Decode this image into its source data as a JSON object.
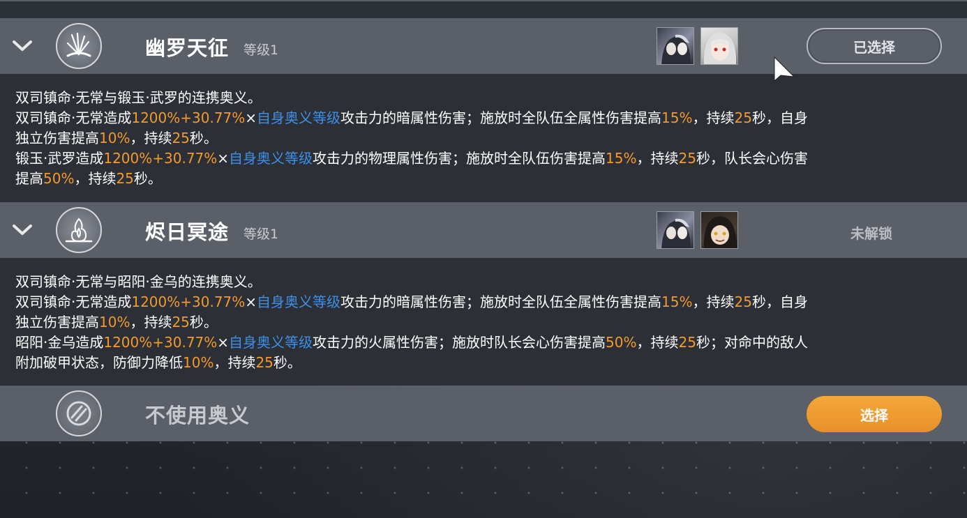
{
  "colors": {
    "header_bg": "#5b5f67",
    "desc_bg": "#2c2f35",
    "highlight_orange": "#f39a2d",
    "highlight_blue": "#3f8fe6",
    "select_button": "#f0a032"
  },
  "skills": [
    {
      "name": "幽罗天征",
      "level": "等级1",
      "status": "已选择",
      "icon": "burst-emblem-icon",
      "lines": [
        [
          "双司镇命·无常与锻玉·武罗的连携奥义。"
        ],
        [
          "双司镇命·无常造成",
          "1200%+30.77%",
          "×",
          "自身奥义等级",
          "攻击力的暗属性伤害；施放时全队伍全属性伤害提高",
          "15%",
          "，持续",
          "25",
          "秒，自身"
        ],
        [
          "独立伤害提高",
          "10%",
          "，持续",
          "25",
          "秒。"
        ],
        [
          "锻玉·武罗造成",
          "1200%+30.77%",
          "×",
          "自身奥义等级",
          "攻击力的物理属性伤害；施放时全队伍伤害提高",
          "15%",
          "，持续",
          "25",
          "秒，队长会心伤害"
        ],
        [
          "提高",
          "50%",
          "，持续",
          "25",
          "秒。"
        ]
      ]
    },
    {
      "name": "烬日冥途",
      "level": "等级1",
      "status": "未解锁",
      "icon": "flame-emblem-icon",
      "lines": [
        [
          "双司镇命·无常与昭阳·金乌的连携奥义。"
        ],
        [
          "双司镇命·无常造成",
          "1200%+30.77%",
          "×",
          "自身奥义等级",
          "攻击力的暗属性伤害；施放时全队伍全属性伤害提高",
          "15%",
          "，持续",
          "25",
          "秒，自身"
        ],
        [
          "独立伤害提高",
          "10%",
          "，持续",
          "25",
          "秒。"
        ],
        [
          "昭阳·金乌造成",
          "1200%+30.77%",
          "×",
          "自身奥义等级",
          "攻击力的火属性伤害；施放时队长会心伤害提高",
          "50%",
          "，持续",
          "25",
          "秒；对命中的敌人"
        ],
        [
          "附加破甲状态，防御力降低",
          "10%",
          "，持续",
          "25",
          "秒。"
        ]
      ]
    }
  ],
  "none_option": {
    "label": "不使用奥义",
    "button": "选择",
    "icon": "no-skill-icon"
  }
}
